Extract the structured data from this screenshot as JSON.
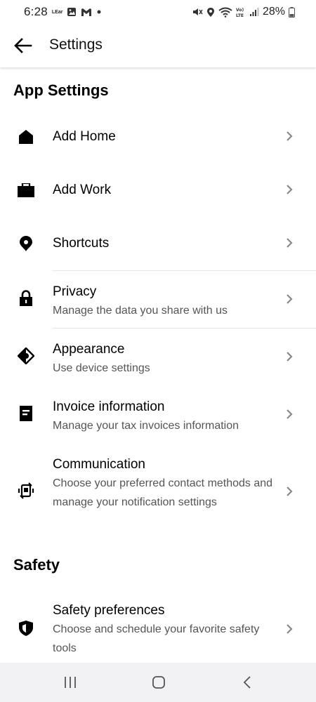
{
  "status_bar": {
    "time": "6:28",
    "carrier_tag": "LEar",
    "battery": "28%"
  },
  "app_bar": {
    "title": "Settings"
  },
  "sections": {
    "app_settings": "App Settings",
    "safety": "Safety"
  },
  "items": [
    {
      "label": "Add Home",
      "sub": "",
      "icon": "home-icon"
    },
    {
      "label": "Add Work",
      "sub": "",
      "icon": "briefcase-icon"
    },
    {
      "label": "Shortcuts",
      "sub": "",
      "icon": "location-pin-icon"
    },
    {
      "label": "Privacy",
      "sub": "Manage the data you share with us",
      "icon": "lock-icon"
    },
    {
      "label": "Appearance",
      "sub": "Use device settings",
      "icon": "appearance-icon"
    },
    {
      "label": "Invoice information",
      "sub": "Manage your tax invoices information",
      "icon": "invoice-icon"
    },
    {
      "label": "Communication",
      "sub": "Choose your preferred contact methods and manage your notification settings",
      "icon": "communication-icon"
    },
    {
      "label": "Safety preferences",
      "sub": "Choose and schedule your favorite safety tools",
      "icon": "shield-icon"
    }
  ],
  "colors": {
    "text_primary": "#000000",
    "text_secondary": "#555555",
    "chevron": "#888888",
    "divider": "#e6e6e6",
    "navbar_bg": "#f2f2f4"
  }
}
